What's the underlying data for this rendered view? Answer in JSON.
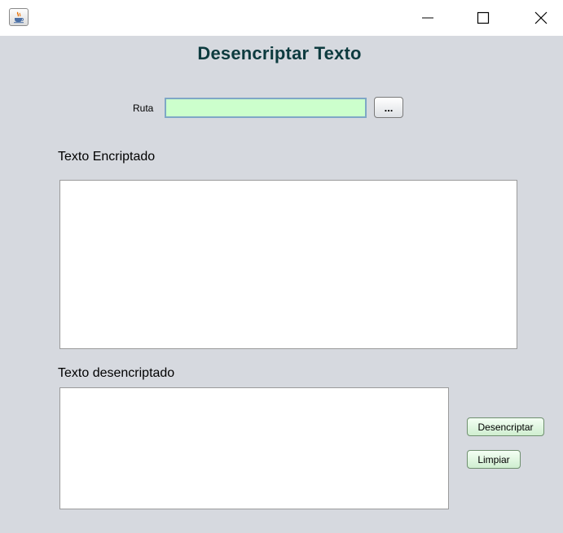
{
  "window": {
    "icon": "java-coffee-icon",
    "controls": {
      "minimize": "minimize-icon",
      "maximize": "maximize-icon",
      "close": "close-icon"
    }
  },
  "form": {
    "heading": "Desencriptar Texto",
    "ruta": {
      "label": "Ruta",
      "value": "",
      "placeholder": ""
    },
    "browse_label": "...",
    "encrypted": {
      "label": "Texto Encriptado",
      "value": ""
    },
    "decrypted": {
      "label": "Texto desencriptado",
      "value": ""
    },
    "buttons": {
      "decrypt": "Desencriptar",
      "clear": "Limpiar"
    }
  },
  "colors": {
    "background": "#d6d9df",
    "heading": "#0d3b3f",
    "input_bg": "#ccffcc",
    "input_border": "#7fa7c6",
    "action_button_bg": "#cfeed0"
  }
}
